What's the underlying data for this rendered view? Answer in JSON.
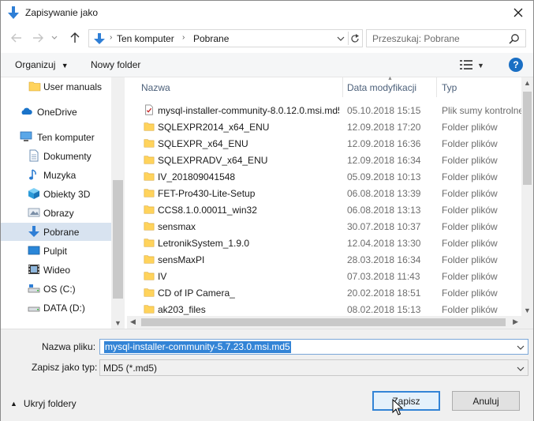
{
  "window": {
    "title": "Zapisywanie jako",
    "colors": {
      "accent": "#3384d6",
      "folder": "#ffd35c",
      "help": "#1a6fc4",
      "selected_bg": "#d8e3f0"
    }
  },
  "address": {
    "crumbs": [
      "Ten komputer",
      "Pobrane"
    ],
    "search_placeholder": "Przeszukaj: Pobrane"
  },
  "toolbar": {
    "organize_label": "Organizuj",
    "new_folder_label": "Nowy folder",
    "help_label": "?"
  },
  "sidebar": {
    "items": [
      {
        "label": "User manuals",
        "icon": "folder-icon"
      },
      {
        "label": "OneDrive",
        "icon": "cloud-icon"
      },
      {
        "label": "Ten komputer",
        "icon": "computer-icon"
      },
      {
        "label": "Dokumenty",
        "icon": "documents-icon"
      },
      {
        "label": "Muzyka",
        "icon": "music-icon"
      },
      {
        "label": "Obiekty 3D",
        "icon": "cube-icon"
      },
      {
        "label": "Obrazy",
        "icon": "pictures-icon"
      },
      {
        "label": "Pobrane",
        "icon": "download-icon",
        "selected": true
      },
      {
        "label": "Pulpit",
        "icon": "desktop-icon"
      },
      {
        "label": "Wideo",
        "icon": "video-icon"
      },
      {
        "label": "OS (C:)",
        "icon": "drive-icon"
      },
      {
        "label": "DATA (D:)",
        "icon": "drive-icon"
      }
    ]
  },
  "file_list": {
    "columns": [
      "Nazwa",
      "Data modyfikacji",
      "Typ"
    ],
    "rows": [
      {
        "name": "mysql-installer-community-8.0.12.0.msi.md5",
        "date": "05.10.2018 15:15",
        "type": "Plik sumy kontrolnej",
        "icon": "checksum-file-icon"
      },
      {
        "name": "SQLEXPR2014_x64_ENU",
        "date": "12.09.2018 17:20",
        "type": "Folder plików",
        "icon": "folder-icon"
      },
      {
        "name": "SQLEXPR_x64_ENU",
        "date": "12.09.2018 16:36",
        "type": "Folder plików",
        "icon": "folder-icon"
      },
      {
        "name": "SQLEXPRADV_x64_ENU",
        "date": "12.09.2018 16:34",
        "type": "Folder plików",
        "icon": "folder-icon"
      },
      {
        "name": "IV_201809041548",
        "date": "05.09.2018 10:13",
        "type": "Folder plików",
        "icon": "folder-icon"
      },
      {
        "name": "FET-Pro430-Lite-Setup",
        "date": "06.08.2018 13:39",
        "type": "Folder plików",
        "icon": "folder-icon"
      },
      {
        "name": "CCS8.1.0.00011_win32",
        "date": "06.08.2018 13:13",
        "type": "Folder plików",
        "icon": "folder-icon"
      },
      {
        "name": "sensmax",
        "date": "30.07.2018 10:37",
        "type": "Folder plików",
        "icon": "folder-icon"
      },
      {
        "name": "LetronikSystem_1.9.0",
        "date": "12.04.2018 13:30",
        "type": "Folder plików",
        "icon": "folder-icon"
      },
      {
        "name": "sensMaxPI",
        "date": "28.03.2018 16:34",
        "type": "Folder plików",
        "icon": "folder-icon"
      },
      {
        "name": "IV",
        "date": "07.03.2018 11:43",
        "type": "Folder plików",
        "icon": "folder-icon"
      },
      {
        "name": "CD of IP Camera_",
        "date": "20.02.2018 18:51",
        "type": "Folder plików",
        "icon": "folder-icon"
      },
      {
        "name": "ak203_files",
        "date": "08.02.2018 15:13",
        "type": "Folder plików",
        "icon": "folder-icon"
      }
    ]
  },
  "form": {
    "filename_label": "Nazwa pliku:",
    "filename_value": "mysql-installer-community-5.7.23.0.msi.md5",
    "type_label": "Zapisz jako typ:",
    "type_value": "MD5 (*.md5)",
    "hide_folders_label": "Ukryj foldery",
    "save_label": "Zapisz",
    "cancel_label": "Anuluj"
  }
}
